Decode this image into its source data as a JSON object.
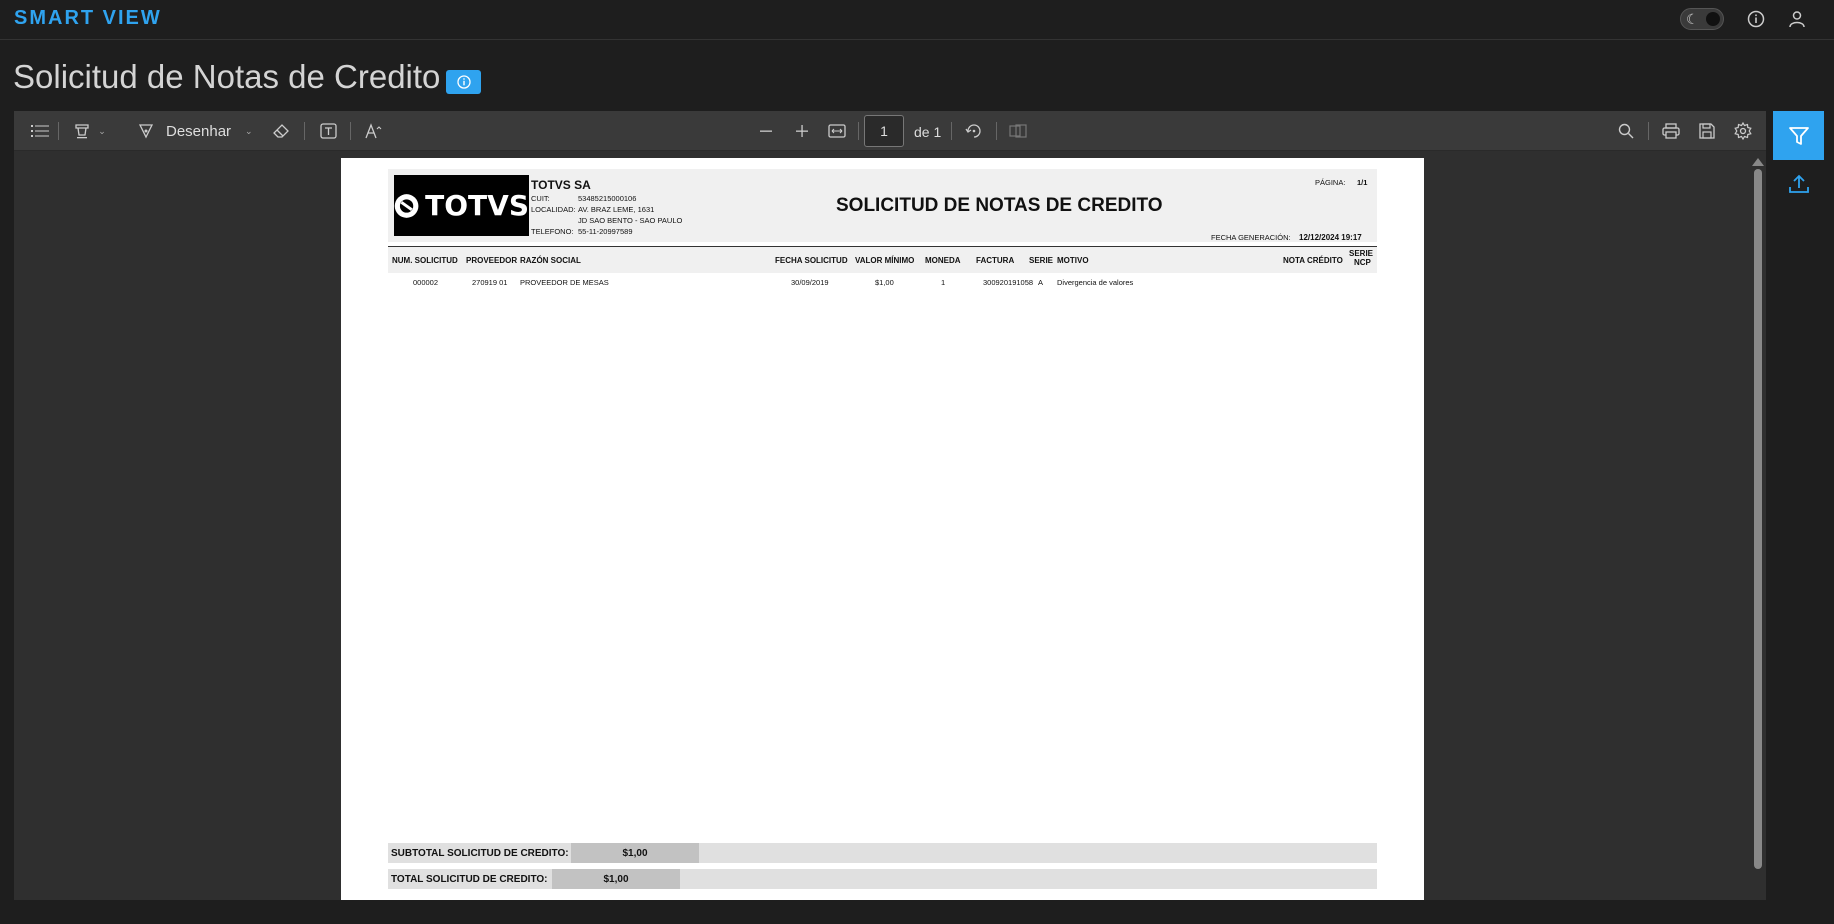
{
  "app": {
    "brand": "SMART VIEW"
  },
  "page": {
    "title": "Solicitud de Notas de Credito"
  },
  "toolbar": {
    "draw_label": "Desenhar",
    "current_page": "1",
    "page_of": "de 1"
  },
  "report": {
    "company": "TOTVS SA",
    "logo_text": "TOTVS",
    "title": "SOLICITUD DE NOTAS DE CREDITO",
    "info": [
      {
        "label": "CUIT:",
        "value": "53485215000106"
      },
      {
        "label": "LOCALIDAD:",
        "value": "AV. BRAZ LEME, 1631"
      },
      {
        "label": "",
        "value": "JD SAO BENTO - SAO PAULO"
      },
      {
        "label": "TELEFONO:",
        "value": "55-11-20997589"
      }
    ],
    "page_label": "PÁGINA:",
    "page_value": "1/1",
    "gen_label": "FECHA GENERACIÓN:",
    "gen_value": "12/12/2024 19:17",
    "columns": {
      "num": "NUM. SOLICITUD",
      "prov": "PROVEEDOR",
      "razon": "RAZÓN SOCIAL",
      "fecha": "FECHA SOLICITUD",
      "valor": "VALOR MÍNIMO",
      "moneda": "MONEDA",
      "factura": "FACTURA",
      "serie": "SERIE",
      "motivo": "MOTIVO",
      "nota": "NOTA CRÉDITO",
      "serie_ncp_1": "SERIE",
      "serie_ncp_2": "NCP"
    },
    "row": {
      "num": "000002",
      "prov": "270919 01",
      "razon": "PROVEEDOR DE MESAS",
      "fecha": "30/09/2019",
      "valor": "$1,00",
      "moneda": "1",
      "factura": "300920191058",
      "serie": "A",
      "motivo": "Divergencia de valores"
    },
    "subtotal_label": "SUBTOTAL SOLICITUD DE CREDITO:",
    "subtotal_value": "$1,00",
    "total_label": "TOTAL SOLICITUD DE CREDITO:",
    "total_value": "$1,00"
  },
  "colors": {
    "accent": "#2fa3ef",
    "background": "#1e1e1e",
    "toolbar": "#3a3a3a"
  },
  "icons": [
    "moon-icon",
    "info-icon",
    "user-icon",
    "outline-icon",
    "highlight-icon",
    "draw-icon",
    "eraser-icon",
    "textbox-icon",
    "text-size-icon",
    "zoom-out-icon",
    "zoom-in-icon",
    "fit-width-icon",
    "rotate-icon",
    "presentation-icon",
    "search-icon",
    "print-icon",
    "save-icon",
    "settings-icon",
    "filter-icon",
    "upload-icon"
  ]
}
